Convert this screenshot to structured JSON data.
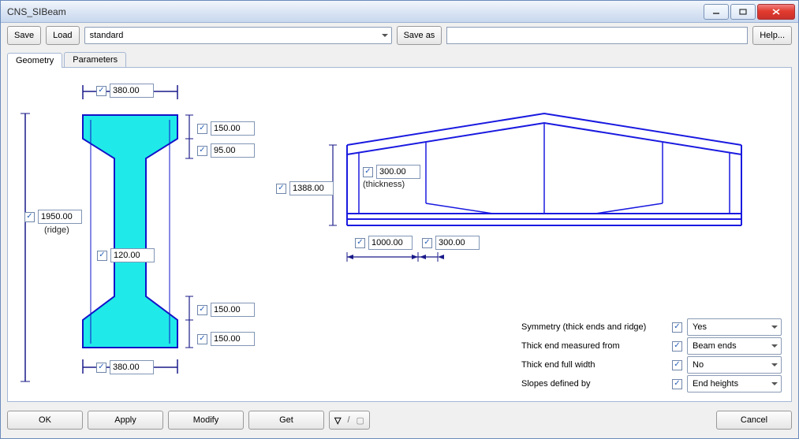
{
  "window": {
    "title": "CNS_SIBeam"
  },
  "toolbar": {
    "save": "Save",
    "load": "Load",
    "preset": "standard",
    "save_as": "Save as",
    "save_as_name": "",
    "help": "Help..."
  },
  "tabs": {
    "geometry": "Geometry",
    "parameters": "Parameters"
  },
  "dims": {
    "top_width": "380.00",
    "bottom_width": "380.00",
    "total_height": "1950.00",
    "total_height_note": "(ridge)",
    "top_flange_h1": "150.00",
    "top_flange_h2": "95.00",
    "web_width": "120.00",
    "bot_flange_h1": "150.00",
    "bot_flange_h2": "150.00",
    "elev_height": "1388.00",
    "thickness": "300.00",
    "thickness_note": "(thickness)",
    "span_seg1": "1000.00",
    "span_seg2": "300.00"
  },
  "options": {
    "symmetry_label": "Symmetry (thick ends and ridge)",
    "symmetry_value": "Yes",
    "thick_from_label": "Thick end measured from",
    "thick_from_value": "Beam ends",
    "thick_full_label": "Thick end full width",
    "thick_full_value": "No",
    "slopes_label": "Slopes defined by",
    "slopes_value": "End heights"
  },
  "bottom": {
    "ok": "OK",
    "apply": "Apply",
    "modify": "Modify",
    "get": "Get",
    "cancel": "Cancel",
    "toggle_on": "⌐",
    "toggle_off": "⌐"
  }
}
